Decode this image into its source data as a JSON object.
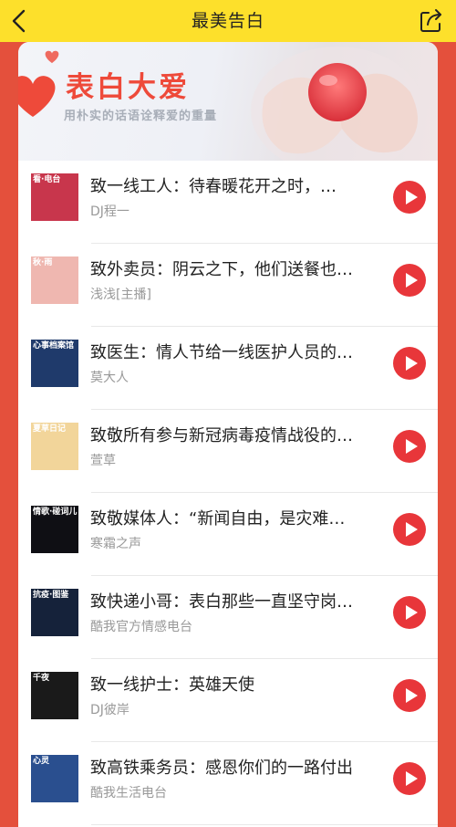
{
  "header": {
    "title": "最美告白",
    "back_icon": "chevron-left-icon",
    "share_icon": "share-icon"
  },
  "banner": {
    "title": "表白大爱",
    "subtitle": "用朴实的话语诠释爱的重量"
  },
  "colors": {
    "accent": "#e8363a",
    "header_bg": "#fde02b",
    "page_bg": "#e4503c"
  },
  "items": [
    {
      "title": "致一线工人：待春暖花开之时，…",
      "author": "DJ程一",
      "thumb_text": "看·电台",
      "thumb_color": "#c8364c"
    },
    {
      "title": "致外卖员：阴云之下，他们送餐也…",
      "author": "浅浅[主播]",
      "thumb_text": "秋·雨",
      "thumb_color": "#efb7b0"
    },
    {
      "title": "致医生：情人节给一线医护人员的…",
      "author": "莫大人",
      "thumb_text": "心事档案馆",
      "thumb_color": "#1f3a6b"
    },
    {
      "title": "致敬所有参与新冠病毒疫情战役的…",
      "author": "萱草",
      "thumb_text": "夏草日记",
      "thumb_color": "#f2d59a"
    },
    {
      "title": "致敬媒体人：“新闻自由，是灾难…",
      "author": "寒霜之声",
      "thumb_text": "情歌·碰词儿",
      "thumb_color": "#0f0f14"
    },
    {
      "title": "致快递小哥：表白那些一直坚守岗…",
      "author": "酷我官方情感电台",
      "thumb_text": "抗疫·图鉴",
      "thumb_color": "#15223a"
    },
    {
      "title": "致一线护士：英雄天使",
      "author": "DJ彼岸",
      "thumb_text": "千夜",
      "thumb_color": "#1a1a1a"
    },
    {
      "title": "致高铁乘务员：感恩你们的一路付出",
      "author": "酷我生活电台",
      "thumb_text": "心灵",
      "thumb_color": "#2a4f8f"
    }
  ]
}
